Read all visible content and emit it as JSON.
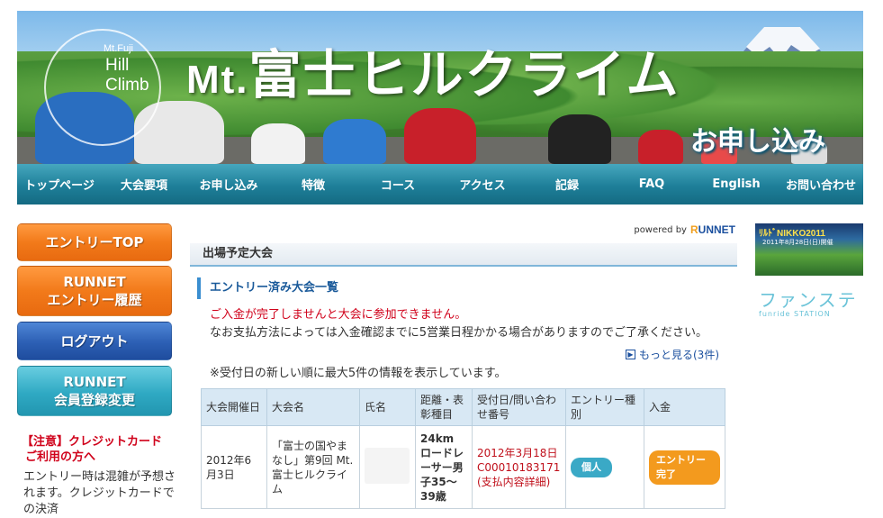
{
  "banner": {
    "logo_small": "Mt.Fuji",
    "logo_line1": "Hill",
    "logo_line2": "Climb",
    "title_prefix": "Mt.",
    "title_main": "富士ヒルクライム",
    "apply_label": "お申し込み"
  },
  "nav": [
    "トップページ",
    "大会要項",
    "お申し込み",
    "特徴",
    "コース",
    "アクセス",
    "記録",
    "FAQ",
    "English",
    "お問い合わせ"
  ],
  "sidebar": {
    "entry_top": "エントリーTOP",
    "history_line1": "RUNNET",
    "history_line2": "エントリー履歴",
    "logout": "ログアウト",
    "member_line1": "RUNNET",
    "member_line2": "会員登録変更",
    "notice_line1": "【注意】クレジットカード",
    "notice_line2": "ご利用の方へ",
    "notice_body": "エントリー時は混雑が予想されます。クレジットカードでの決済"
  },
  "main": {
    "powered_by": "powered by",
    "runnet_a": "R",
    "runnet_b": "UNNET",
    "section_title": "出場予定大会",
    "subsection_title": "エントリー済み大会一覧",
    "warning": "ご入金が完了しませんと大会に参加できません。",
    "note_payment": "なお支払方法によっては入金確認までに5営業日程かかる場合がありますのでご了承ください。",
    "more_link": "もっと見る(3件)",
    "note_recent": "※受付日の新しい順に最大5件の情報を表示しています。",
    "table": {
      "headers": [
        "大会開催日",
        "大会名",
        "氏名",
        "距離・表彰種目",
        "受付日/問い合わせ番号",
        "エントリー種別",
        "入金"
      ],
      "rows": [
        {
          "date": "2012年6月3日",
          "event": "「富士の国やまなし」第9回 Mt.富士ヒルクライム",
          "name": "",
          "category": "24km ロードレーサー男子35～39歳",
          "received": "2012年3月18日",
          "inquiry_no": "C00010183171",
          "detail_link": "(支払内容詳細)",
          "entry_type": "個人",
          "payment": "エントリー完了"
        }
      ]
    }
  },
  "right_ads": {
    "nikko_title": "ﾘﾙﾄﾞNIKKO2011",
    "nikko_date": "2011年8月28日(日)開催",
    "funste_jp": "ファンステ",
    "funste_en": "funride STATION"
  },
  "colors": {
    "nav_blue": "#1e7f99",
    "orange_button": "#f27a1a",
    "blue_button": "#2c5fb4",
    "teal_button": "#2fa9c3",
    "warning_red": "#d0021b"
  }
}
